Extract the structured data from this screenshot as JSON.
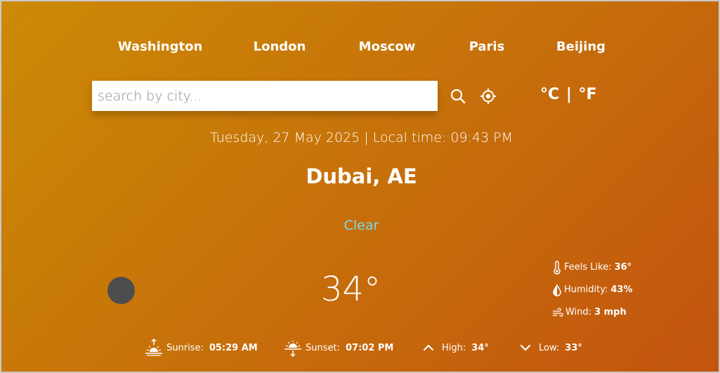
{
  "nav": {
    "cities": [
      "Washington",
      "London",
      "Moscow",
      "Paris",
      "Beijing"
    ]
  },
  "search": {
    "placeholder": "search by city...",
    "value": ""
  },
  "units": {
    "celsius": "°C",
    "separator": "|",
    "fahrenheit": "°F"
  },
  "datetime": "Tuesday, 27 May 2025 | Local time: 09:43 PM",
  "location": "Dubai, AE",
  "condition": "Clear",
  "temperature": "34°",
  "details": {
    "feels_like_label": "Feels Like:",
    "feels_like_value": "36°",
    "humidity_label": "Humidity:",
    "humidity_value": "43%",
    "wind_label": "Wind:",
    "wind_value": "3 mph"
  },
  "bottom": {
    "sunrise_label": "Sunrise:",
    "sunrise_value": "05:29 AM",
    "sunset_label": "Sunset:",
    "sunset_value": "07:02 PM",
    "high_label": "High:",
    "high_value": "34°",
    "low_label": "Low:",
    "low_value": "33°"
  },
  "icons": {
    "search": "search-icon",
    "location": "location-crosshair-icon",
    "weather": "weather-condition-icon",
    "thermometer": "thermometer-icon",
    "humidity": "droplet-icon",
    "wind": "wind-icon",
    "sunrise": "sunrise-icon",
    "sunset": "sunset-icon",
    "high": "chevron-up-icon",
    "low": "chevron-down-icon"
  },
  "colors": {
    "background_start": "#cc8a05",
    "background_end": "#c2540f",
    "condition_text": "#7fd8e8",
    "weather_icon_placeholder": "#4d4d4d"
  }
}
